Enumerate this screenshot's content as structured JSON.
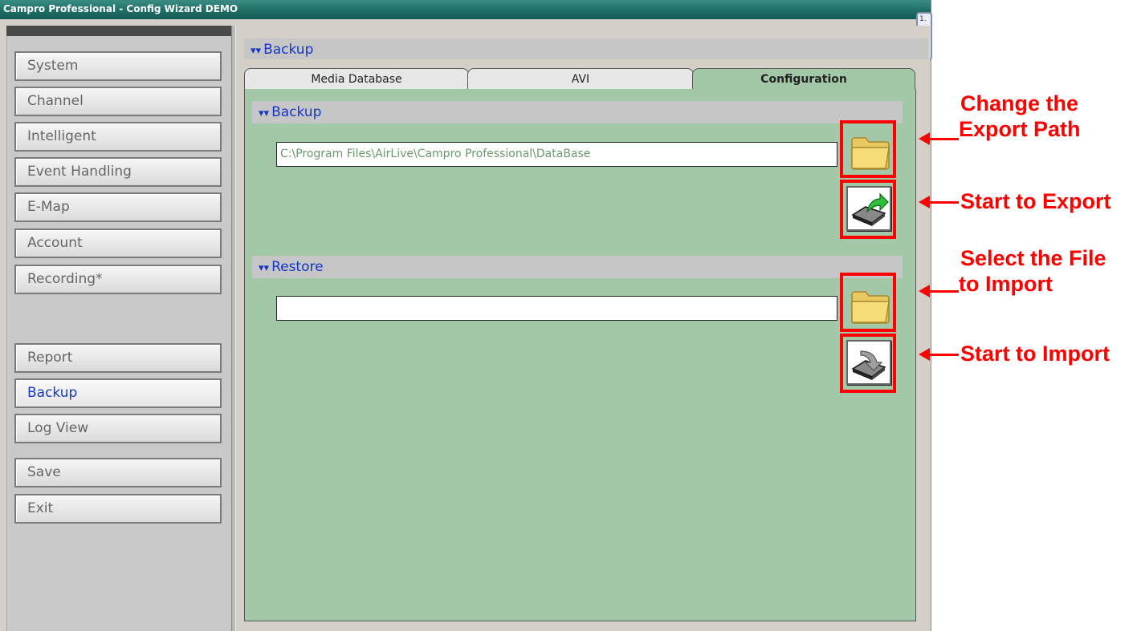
{
  "window": {
    "title": "Campro Professional - Config Wizard DEMO",
    "corner_label": "1."
  },
  "sidebar": {
    "items": [
      {
        "label": "System"
      },
      {
        "label": "Channel"
      },
      {
        "label": "Intelligent"
      },
      {
        "label": "Event Handling"
      },
      {
        "label": "E-Map"
      },
      {
        "label": "Account"
      },
      {
        "label": "Recording*"
      },
      {
        "label": "Report"
      },
      {
        "label": "Backup",
        "active": true
      },
      {
        "label": "Log View"
      },
      {
        "label": "Save"
      },
      {
        "label": "Exit"
      }
    ]
  },
  "main": {
    "header": "Backup",
    "tabs": [
      {
        "label": "Media Database"
      },
      {
        "label": "AVI"
      },
      {
        "label": "Configuration",
        "active": true
      }
    ],
    "backup": {
      "title": "Backup",
      "path_value": "C:\\Program Files\\AirLive\\Campro Professional\\DataBase"
    },
    "restore": {
      "title": "Restore",
      "path_value": ""
    }
  },
  "annotations": {
    "change_path_line1": "Change the",
    "change_path_line2": "Export Path",
    "start_export": "Start to Export",
    "select_file_line1": "Select the File",
    "select_file_line2": "to Import",
    "start_import": "Start to Import"
  },
  "colors": {
    "panel": "#a3c8a8",
    "accent": "#1537c9",
    "annotation": "#ff0000"
  },
  "icons": [
    "folder-icon",
    "export-drive-icon",
    "import-drive-icon"
  ]
}
